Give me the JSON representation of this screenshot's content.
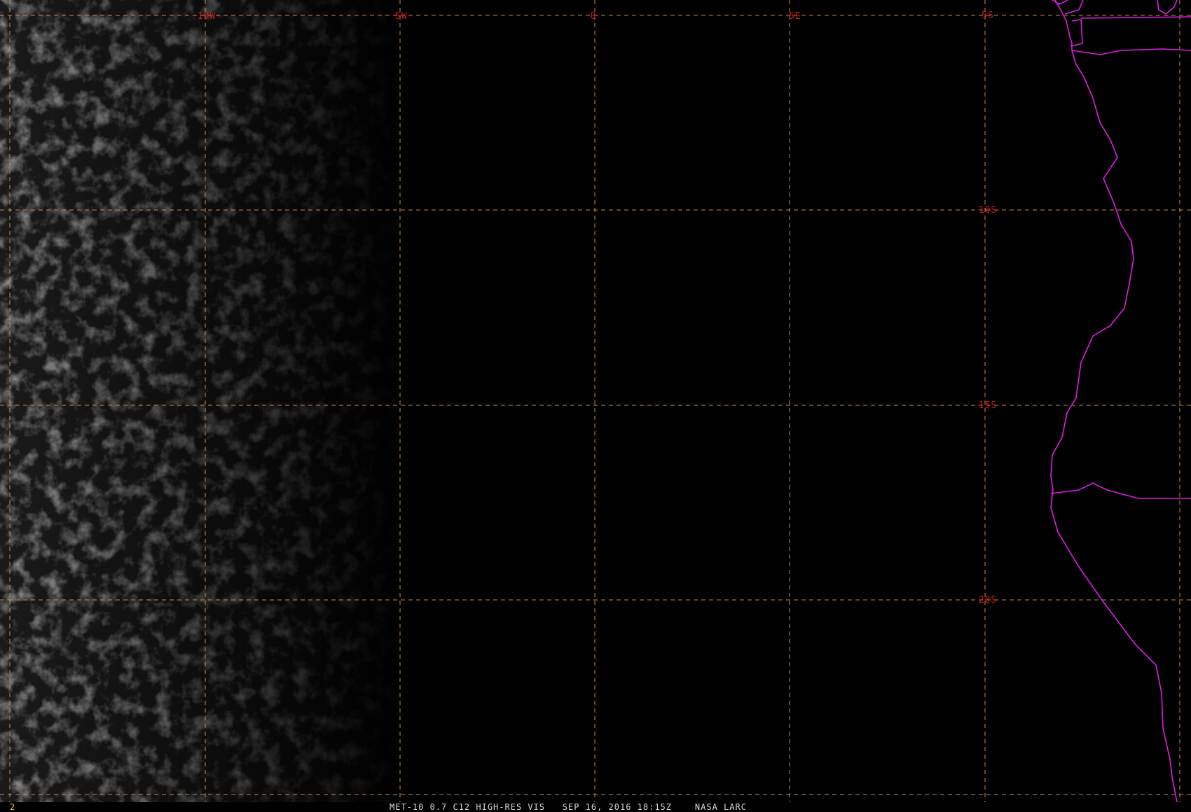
{
  "map": {
    "longitude_labels": [
      "10W",
      "5W",
      "0",
      "5E"
    ],
    "latitude_labels": [
      "5S",
      "10S",
      "15S",
      "20S"
    ],
    "colors": {
      "background": "#000000",
      "grid": "#c98a4a",
      "grid_labels": "#d01818",
      "coastline": "#e01ee0",
      "cloud": "#8a8a8a"
    }
  },
  "status_bar": {
    "frame_number": "2",
    "caption": "MET-10 0.7 C12 HIGH-RES VIS   SEP 16, 2016 18:15Z    NASA LARC"
  }
}
